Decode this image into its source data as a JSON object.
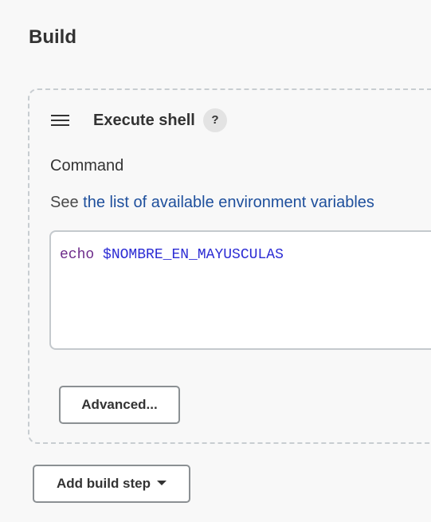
{
  "section": {
    "title": "Build"
  },
  "step": {
    "title": "Execute shell",
    "help_label": "?",
    "command_label": "Command",
    "env_prefix": "See",
    "env_link": "the list of available environment variables",
    "command": {
      "keyword": "echo",
      "variable": "$NOMBRE_EN_MAYUSCULAS"
    },
    "advanced_label": "Advanced..."
  },
  "footer": {
    "add_step_label": "Add build step"
  },
  "icons": {
    "drag": "drag-handle-icon",
    "dropdown": "chevron-down-icon"
  },
  "colors": {
    "link": "#1e4f9c",
    "keyword": "#6d2b8a",
    "variable": "#2b2bd4"
  }
}
